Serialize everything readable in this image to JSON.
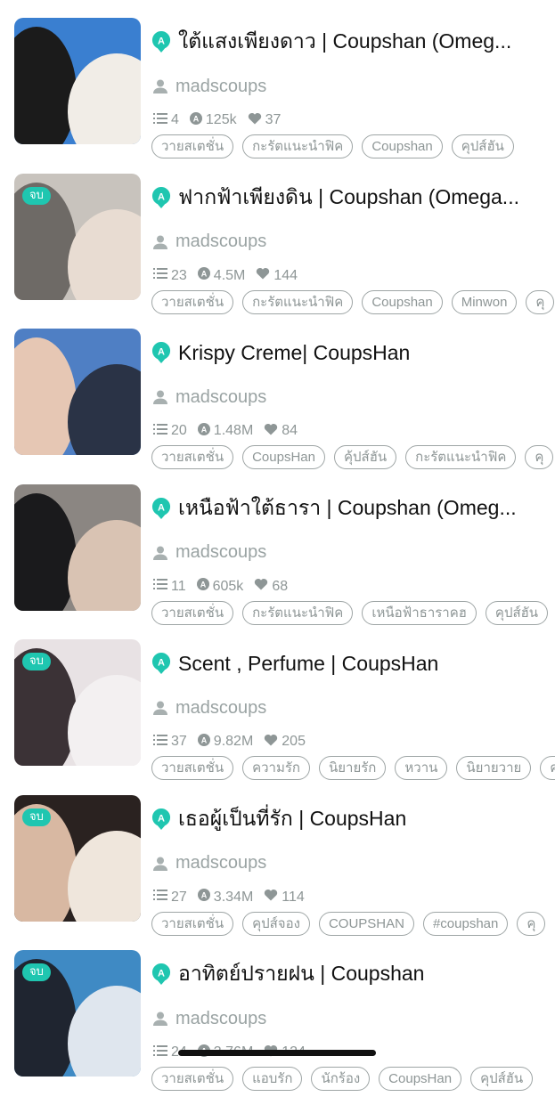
{
  "colors": {
    "accent": "#1fc6b0",
    "title_text": "#111111",
    "meta_text": "#8e9696"
  },
  "icons": {
    "read_badge": "a-circle-icon",
    "author": "user-icon",
    "chapters": "list-icon",
    "views": "a-circle-icon",
    "likes": "heart-icon"
  },
  "stories": [
    {
      "completed_label": "",
      "title": "ใต้แสงเพียงดาว | Coupshan (Omeg...",
      "author": "madscoups",
      "chapters": "4",
      "views": "125k",
      "likes": "37",
      "tags": [
        "วายสเตชั่น",
        "กะรัตแนะนำฟิค",
        "Coupshan",
        "คุปส์ฮัน"
      ],
      "cover": {
        "bg": "#3a7fd0",
        "a": "#1b1b1b",
        "b": "#f1ede7"
      }
    },
    {
      "completed_label": "จบ",
      "title": "ฟากฟ้าเพียงดิน | Coupshan (Omega...",
      "author": "madscoups",
      "chapters": "23",
      "views": "4.5M",
      "likes": "144",
      "tags": [
        "วายสเตชั่น",
        "กะรัตแนะนำฟิค",
        "Coupshan",
        "Minwon",
        "คุ"
      ],
      "cover": {
        "bg": "#c8c3bd",
        "a": "#6e6a66",
        "b": "#e8dcd2"
      }
    },
    {
      "completed_label": "",
      "title": "Krispy Creme| CoupsHan",
      "author": "madscoups",
      "chapters": "20",
      "views": "1.48M",
      "likes": "84",
      "tags": [
        "วายสเตชั่น",
        "CoupsHan",
        "คุ้ปส์ฮัน",
        "กะรัตแนะนำฟิค",
        "คุ"
      ],
      "cover": {
        "bg": "#4f7fc4",
        "a": "#e6c7b4",
        "b": "#2a3346"
      }
    },
    {
      "completed_label": "",
      "title": "เหนือฟ้าใต้ธารา | Coupshan (Omeg...",
      "author": "madscoups",
      "chapters": "11",
      "views": "605k",
      "likes": "68",
      "tags": [
        "วายสเตชั่น",
        "กะรัตแนะนำฟิค",
        "เหนือฟ้าธาราคฮ",
        "คุปส์ฮัน"
      ],
      "cover": {
        "bg": "#8b8682",
        "a": "#1a1a1c",
        "b": "#d9c3b3"
      }
    },
    {
      "completed_label": "จบ",
      "title": "Scent , Perfume | CoupsHan",
      "author": "madscoups",
      "chapters": "37",
      "views": "9.82M",
      "likes": "205",
      "tags": [
        "วายสเตชั่น",
        "ความรัก",
        "นิยายรัก",
        "หวาน",
        "นิยายวาย",
        "คุ"
      ],
      "cover": {
        "bg": "#e8e2e4",
        "a": "#3b3236",
        "b": "#f3f0f1"
      }
    },
    {
      "completed_label": "จบ",
      "title": "เธอผู้เป็นที่รัก | CoupsHan",
      "author": "madscoups",
      "chapters": "27",
      "views": "3.34M",
      "likes": "114",
      "tags": [
        "วายสเตชั่น",
        "คุปส์จอง",
        "COUPSHAN",
        "#coupshan",
        "คุ"
      ],
      "cover": {
        "bg": "#2a2220",
        "a": "#d8b8a2",
        "b": "#efe6dc"
      }
    },
    {
      "completed_label": "จบ",
      "title": "อาทิตย์ปรายฝน | Coupshan",
      "author": "madscoups",
      "chapters": "24",
      "views": "3.76M",
      "likes": "124",
      "tags": [
        "วายสเตชั่น",
        "แอบรัก",
        "นักร้อง",
        "CoupsHan",
        "คุปส์ฮัน"
      ],
      "cover": {
        "bg": "#3f8ac4",
        "a": "#1f2530",
        "b": "#dfe6ee"
      }
    }
  ]
}
